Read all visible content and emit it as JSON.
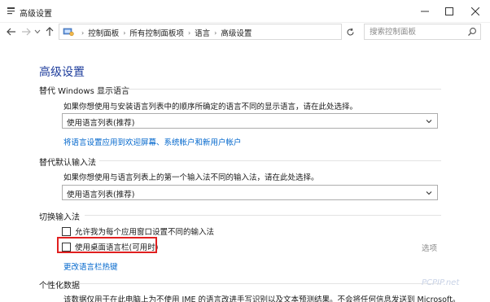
{
  "window": {
    "title": "高级设置"
  },
  "address": {
    "crumbs": [
      "控制面板",
      "所有控制面板项",
      "语言",
      "高级设置"
    ]
  },
  "search": {
    "placeholder": "搜索控制面板"
  },
  "page": {
    "title": "高级设置"
  },
  "display_language": {
    "heading": "替代 Windows 显示语言",
    "description": "如果你想使用与安装语言列表中的顺序所确定的语言不同的显示语言，请在此处选择。",
    "select_value": "使用语言列表(推荐)",
    "link": "将语言设置应用到欢迎屏幕、系统帐户和新用户帐户"
  },
  "default_input": {
    "heading": "替代默认输入法",
    "description": "如果你想使用与语言列表上的第一个输入法不同的输入法，请在此处选择。",
    "select_value": "使用语言列表(推荐)"
  },
  "switch_input": {
    "heading": "切换输入法",
    "checkbox_per_app": "允许我为每个应用窗口设置不同的输入法",
    "checkbox_language_bar": "使用桌面语言栏(可用时)",
    "options_label": "选项",
    "hotkeys_link": "更改语言栏热键"
  },
  "personalization": {
    "heading": "个性化数据",
    "description": "该数据仅用于在此电脑上为不使用 IME 的语言改进手写识别以及文本预测结果。不会将任何信息发送到 Microsoft。"
  },
  "watermark": "PCPIP.net",
  "icons": {
    "app": "settings-icon",
    "up": "up-arrow-icon",
    "breadcrumb": "control-panel-icon",
    "refresh": "refresh-icon",
    "search": "search-icon"
  },
  "colors": {
    "title_blue": "#1e3d9c",
    "link_blue": "#0066cc",
    "highlight_red": "#e02020"
  }
}
